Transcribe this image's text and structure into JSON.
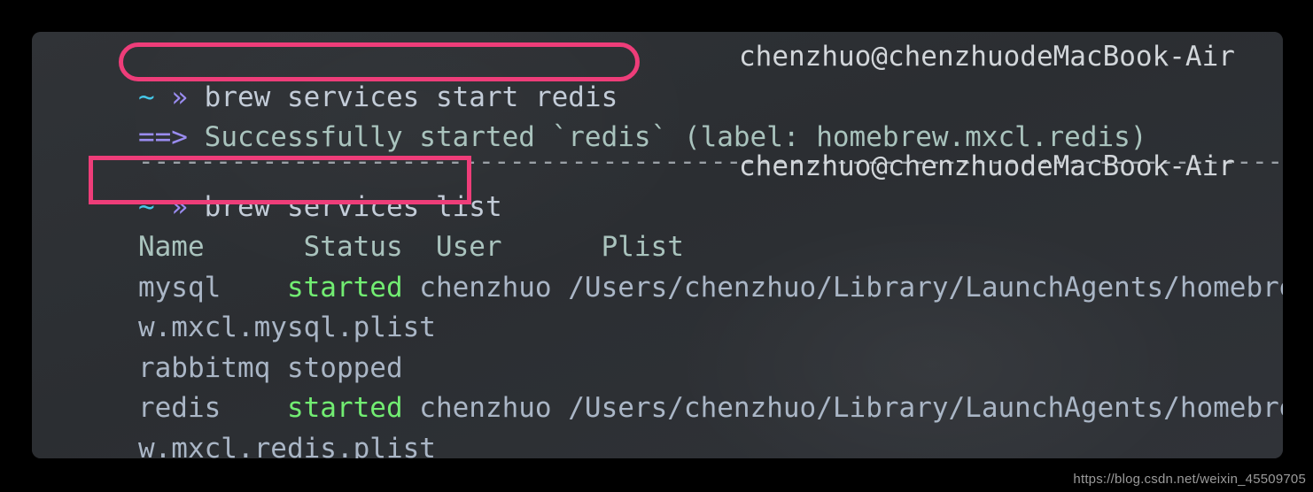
{
  "terminal": {
    "prompt": {
      "symbol_home": "~",
      "symbol_chevron": "»"
    },
    "host": "chenzhuo@chenzhuodeMacBook-Air",
    "lines": [
      {
        "type": "prompt",
        "command": "brew services start redis",
        "host": "chenzhuo@chenzhuodeMacBook-Air"
      },
      {
        "type": "output",
        "marker": "==>",
        "text": "Successfully started `redis` (label: homebrew.mxcl.redis)"
      },
      {
        "type": "separator",
        "text": "------------------------------------------------------------------------------"
      },
      {
        "type": "prompt",
        "command": "brew services list",
        "host": "chenzhuo@chenzhuodeMacBook-Air"
      }
    ],
    "services_table": {
      "headers_line": "Name      Status  User      Plist",
      "headers": [
        "Name",
        "Status",
        "User",
        "Plist"
      ],
      "rows": [
        {
          "name": "mysql",
          "status": "started",
          "user": "chenzhuo",
          "plist": "/Users/chenzhuo/Library/LaunchAgents/homebrew.mxcl.mysql.plist",
          "line_prefix": "mysql    ",
          "line_suffix": " chenzhuo /Users/chenzhuo/Library/LaunchAgents/homebre",
          "wrap_line": "w.mxcl.mysql.plist"
        },
        {
          "name": "rabbitmq",
          "status": "stopped",
          "user": "",
          "plist": "",
          "line_full": "rabbitmq stopped"
        },
        {
          "name": "redis",
          "status": "started",
          "user": "chenzhuo",
          "plist": "/Users/chenzhuo/Library/LaunchAgents/homebrew.mxcl.redis.plist",
          "line_prefix": "redis    ",
          "line_suffix": " chenzhuo /Users/chenzhuo/Library/LaunchAgents/homebre",
          "wrap_line": "w.mxcl.redis.plist"
        }
      ]
    }
  },
  "annotations": {
    "oval_color": "#ee3d79",
    "rect_color": "#ee3d79",
    "oval_target": "brew services start redis",
    "rect_target": "brew services list"
  },
  "watermark": {
    "text": "https://blog.csdn.net/weixin_45509705"
  },
  "colors": {
    "background": "#000000",
    "terminal_bg": "#2c2f33",
    "text": "#b6c0cd",
    "prompt_tilde": "#46c7e8",
    "prompt_chevron": "#9a8cf0",
    "output_marker": "#9a8cf0",
    "status_started": "#72ed72",
    "header_text": "#a9c3bd",
    "highlight_pink": "#ee3d79"
  }
}
